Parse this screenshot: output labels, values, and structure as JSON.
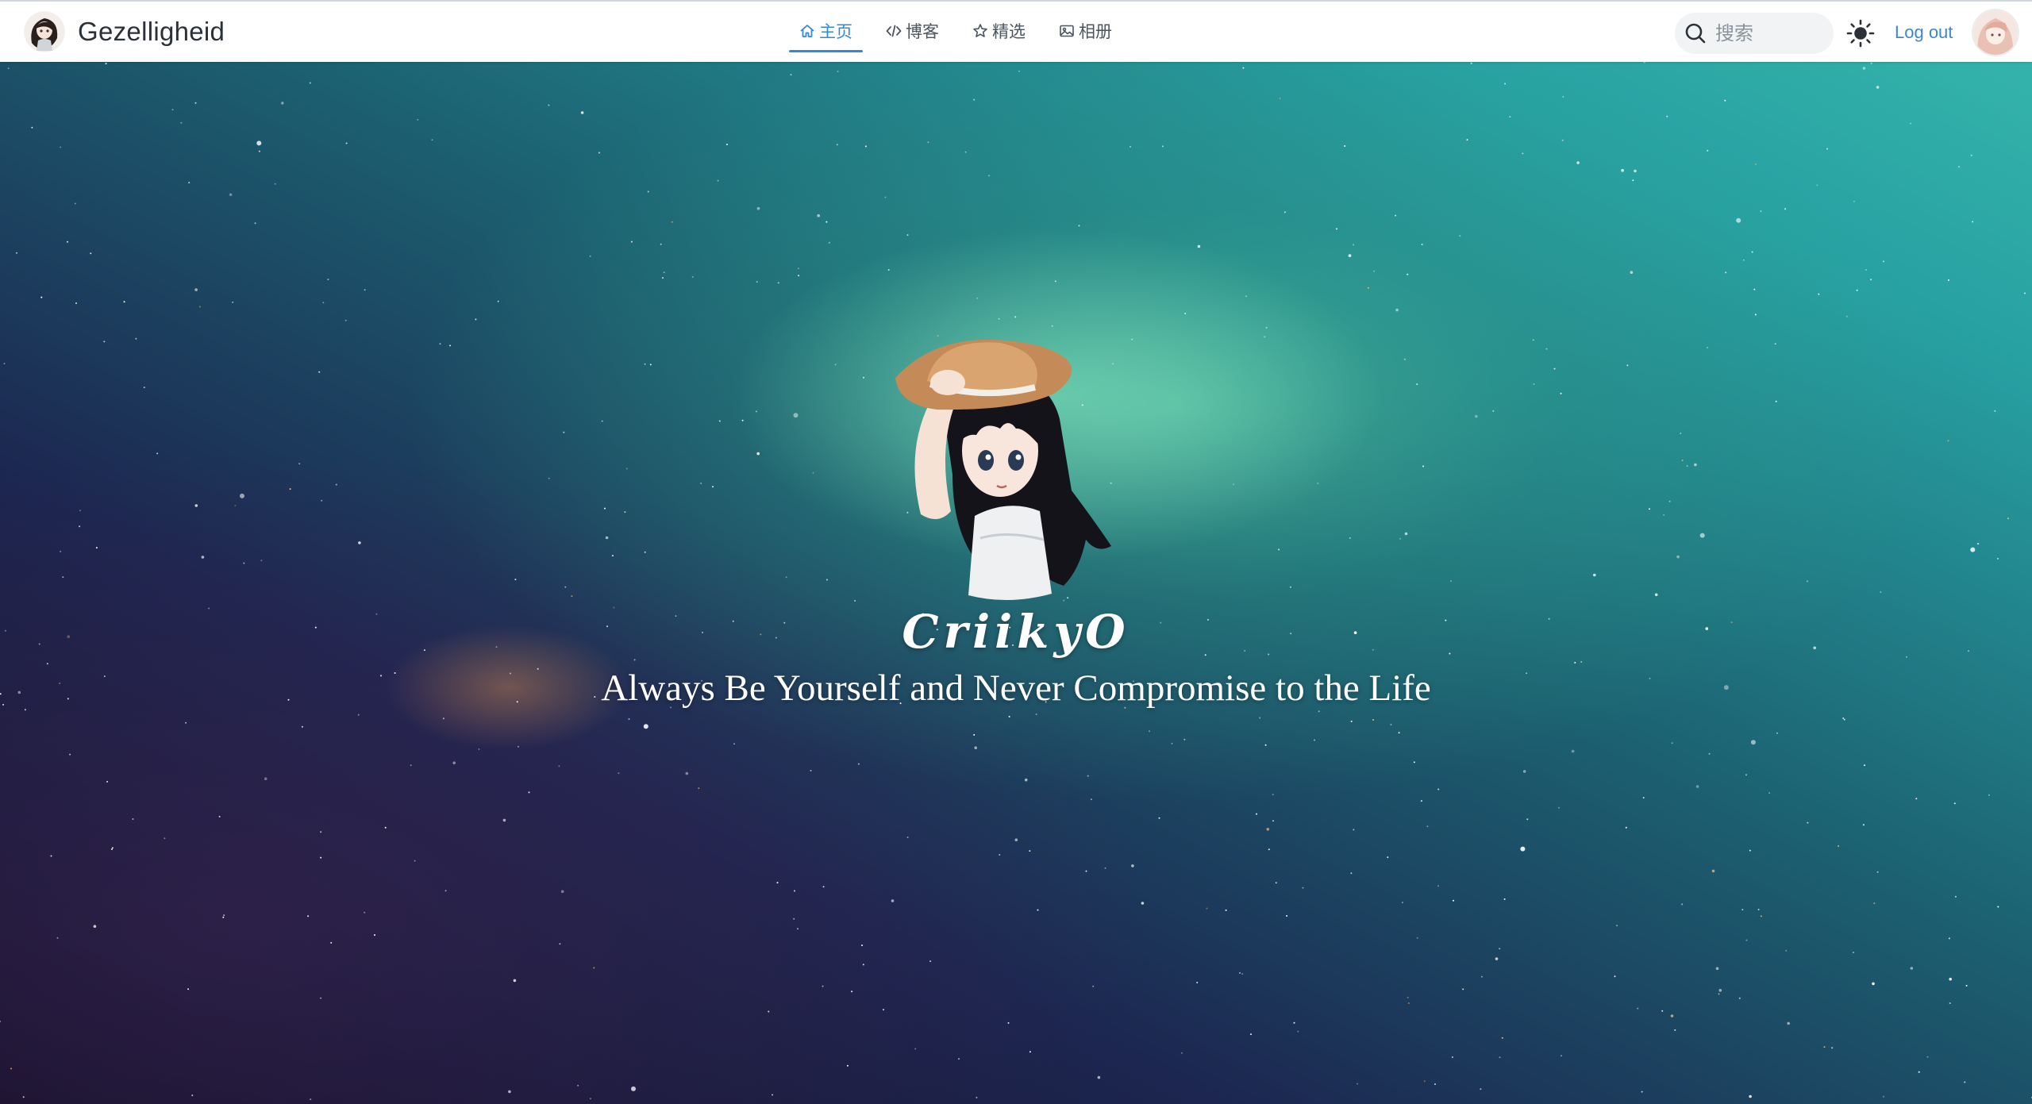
{
  "header": {
    "site_name": "Gezelligheid",
    "nav": [
      {
        "label": "主页",
        "icon": "home-icon",
        "active": true
      },
      {
        "label": "博客",
        "icon": "code-icon",
        "active": false
      },
      {
        "label": "精选",
        "icon": "star-icon",
        "active": false
      },
      {
        "label": "相册",
        "icon": "image-icon",
        "active": false
      }
    ],
    "search": {
      "placeholder": "搜索"
    },
    "theme_toggle_icon": "sun-icon",
    "logout_label": "Log out"
  },
  "hero": {
    "name": "CriikyO",
    "motto": "Always Be Yourself and Never Compromise to the Life"
  },
  "colors": {
    "accent": "#2f8bd8",
    "header_bg": "#ffffff",
    "hero_text": "#ffffff"
  }
}
